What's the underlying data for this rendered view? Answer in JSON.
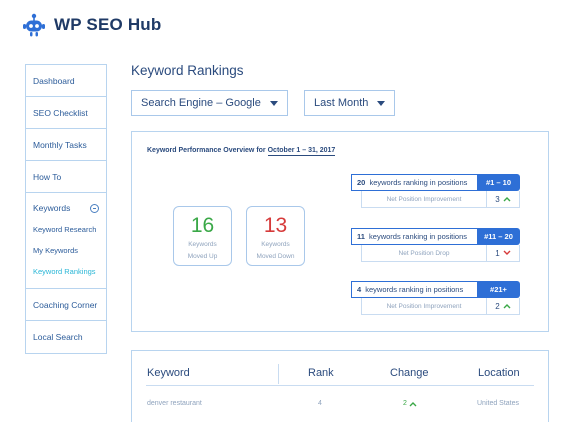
{
  "app": {
    "title": "WP SEO Hub"
  },
  "sidebar": {
    "items": [
      "Dashboard",
      "SEO Checklist",
      "Monthly Tasks",
      "How To"
    ],
    "group": {
      "label": "Keywords",
      "children": [
        "Keyword Research",
        "My Keywords",
        "Keyword Rankings"
      ],
      "active": "Keyword Rankings"
    },
    "items_after": [
      "Coaching Corner",
      "Local Search"
    ]
  },
  "page": {
    "title": "Keyword Rankings"
  },
  "filters": {
    "search_engine": "Search Engine – Google",
    "period": "Last Month"
  },
  "overview": {
    "title_prefix": "Keyword Performance Overview for ",
    "title_period": "October 1 – 31, 2017",
    "moved_up": {
      "value": "16",
      "label1": "Keywords",
      "label2": "Moved Up",
      "color": "#3aa847"
    },
    "moved_down": {
      "value": "13",
      "label1": "Keywords",
      "label2": "Moved Down",
      "color": "#d63a3a"
    },
    "rows": [
      {
        "count": "20",
        "count_text": "keywords ranking in positions",
        "range": "#1 – 10",
        "sub_label": "Net Position Improvement",
        "sub_value": "3",
        "direction": "up"
      },
      {
        "count": "11",
        "count_text": "keywords ranking in positions",
        "range": "#11 – 20",
        "sub_label": "Net Position Drop",
        "sub_value": "1",
        "direction": "down"
      },
      {
        "count": "4",
        "count_text": "keywords ranking in positions",
        "range": "#21+",
        "sub_label": "Net Position Improvement",
        "sub_value": "2",
        "direction": "up"
      }
    ]
  },
  "table": {
    "headers": [
      "Keyword",
      "Rank",
      "Change",
      "Location"
    ],
    "rows": [
      {
        "keyword": "denver restaurant",
        "rank": "4",
        "change": "2",
        "direction": "up",
        "location": "United States"
      }
    ]
  }
}
